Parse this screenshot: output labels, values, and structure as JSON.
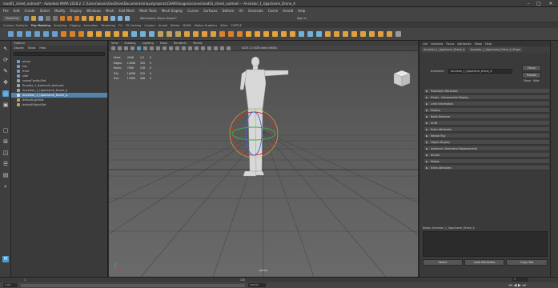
{
  "window": {
    "title": "mod01_street_outmod* - Autodesk MAYA 2018.2: C:\\Users\\alexis\\OneDrive\\Documents\\maya\\projects\\CHAR\\images\\scenes\\mod01_street_outmod  ---  Ancestor_1_Ugachame_Drone_A",
    "minimize": "–",
    "maximize": "□",
    "close": "✕"
  },
  "menubar": [
    "File",
    "Edit",
    "Create",
    "Select",
    "Modify",
    "Display",
    "Windows",
    "Mesh",
    "Edit Mesh",
    "Mesh Tools",
    "Mesh Display",
    "Curves",
    "Surfaces",
    "Deform",
    "UV",
    "Generate",
    "Cache",
    "Arnold",
    "Help"
  ],
  "statusline": {
    "mode": "Modeling",
    "workspace_label": "Workspace: Maya Classic*",
    "sign_in": "Sign In"
  },
  "shelf_tabs": [
    "Curves / Surfaces",
    "Poly Modeling",
    "Sculpting",
    "Rigging",
    "Animation",
    "Rendering",
    "FX",
    "FX Caching",
    "Custom",
    "Arnold",
    "Bifrost",
    "MASH",
    "Motion Graphics",
    "XGen",
    "TURTLE"
  ],
  "outliner": {
    "title": "Outliner",
    "menus": [
      "Display",
      "Show",
      "Help"
    ],
    "items": [
      "persp",
      "top",
      "front",
      "side",
      "sceneConfig:Elet",
      "Rumble_1_Swimsuit_textured",
      "Ancestor_1_Ugachame_Drone_A",
      "Ancestor_1_Ugachame_Drone_A",
      "defaultLightSet",
      "defaultObjectSet"
    ],
    "selected_index": 6
  },
  "viewport": {
    "menus": [
      "View",
      "Shading",
      "Lighting",
      "Show",
      "Renderer",
      "Panels"
    ],
    "hud": [
      [
        "Verts:",
        "4946",
        "4.5",
        "0"
      ],
      [
        "Edges:",
        "14908",
        "345",
        "0"
      ],
      [
        "Faces:",
        "7060",
        "128",
        "0"
      ],
      [
        "Tris:",
        "14098",
        "245",
        "0"
      ],
      [
        "UVs:",
        "17899",
        "406",
        "0"
      ]
    ],
    "color_space": "ACES 1.0 SDR-video (sRGB)",
    "camera": "persp"
  },
  "attribute_editor": {
    "tabs": [
      "List",
      "Selected",
      "Focus",
      "Attributes",
      "Show",
      "Help"
    ],
    "node_tabs": [
      "Ancestor_1_Ugachame_Drone_A",
      "Ancestor_1_Ugachame_Drone_A_Shape"
    ],
    "transform_label": "transform:",
    "transform_value": "Ancestor_1_Ugachame_Drone_A",
    "focus_btn": "Focus",
    "presets_btn": "Presets",
    "show_btn": "Show",
    "hide_btn": "Hide",
    "sections": [
      "Transform Attributes",
      "Pivots - Components Display",
      "Limit Information",
      "Display",
      "Node Behavior",
      "UUID",
      "Extra Attributes",
      "Mental Ray",
      "Object Display",
      "Instancer (Geometry Replacement)",
      "Arnold",
      "Motion",
      "Extra Attributes"
    ],
    "notes": "Notes: Ancestor_1_Ugachame_Drone_A",
    "select_btn": "Select",
    "load_btn": "Load Attributes",
    "copy_btn": "Copy Tab"
  },
  "timeslider": {
    "start": "1",
    "end": "120",
    "current": "1",
    "range_start": "1.00",
    "range_end": "200.00"
  },
  "colors": {
    "selection": "#5284ae",
    "panel_bg": "#3a3a3a",
    "viewport_bg": "#5a5a5a",
    "accent_blue": "#4a9ed4"
  }
}
